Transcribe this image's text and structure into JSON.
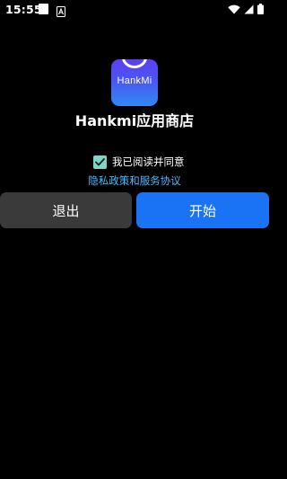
{
  "status_bar": {
    "time": "15:55",
    "icons": [
      "notification-square-icon",
      "a-icon",
      "wifi-icon",
      "signal-icon",
      "battery-icon"
    ]
  },
  "app": {
    "icon_text": "HankMi",
    "title": "Hankmi应用商店",
    "icon_gradient": [
      "#5b3ff6",
      "#2f89f3"
    ]
  },
  "agreement": {
    "checked": true,
    "label": "我已阅读并同意",
    "link_text": "隐私政策和服务协议"
  },
  "buttons": {
    "exit_label": "退出",
    "start_label": "开始"
  },
  "colors": {
    "background": "#000000",
    "checkbox": "#7fd5c4",
    "link": "#4fb8ff",
    "exit_button": "#3a3a3a",
    "start_button": "#1a73f5"
  }
}
